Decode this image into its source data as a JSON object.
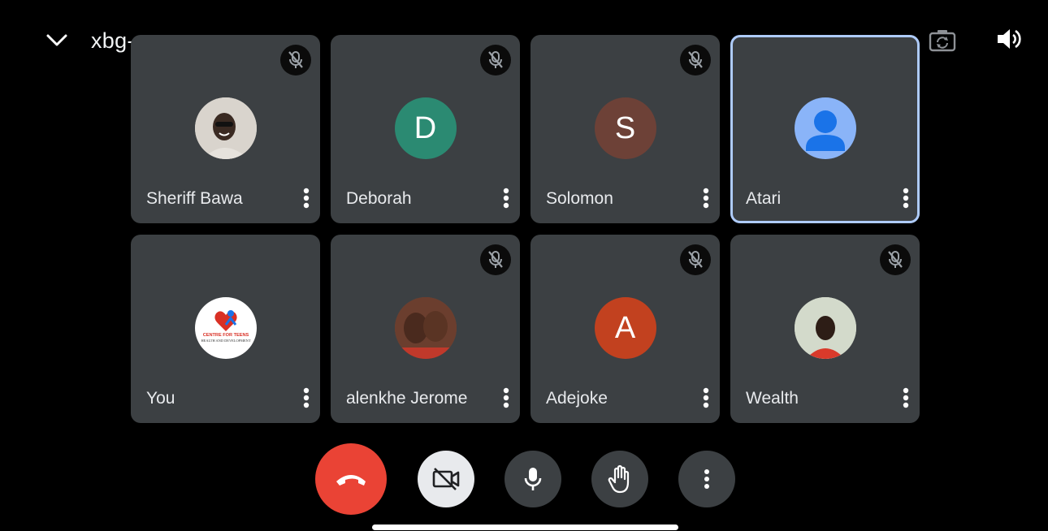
{
  "header": {
    "meeting_code": "xbg-napv-nog",
    "collapse_icon": "chevron-down-icon",
    "expand_icon": "caret-right-icon",
    "camera_switch_icon": "camera-flip-icon",
    "speaker_icon": "speaker-icon"
  },
  "participants": [
    {
      "name": "Sheriff Bawa",
      "avatar_type": "photo",
      "avatar_letter": "",
      "avatar_color": "#cfcac4",
      "muted": true,
      "active": false
    },
    {
      "name": "Deborah",
      "avatar_type": "letter",
      "avatar_letter": "D",
      "avatar_color": "#2b8a72",
      "muted": true,
      "active": false
    },
    {
      "name": "Solomon",
      "avatar_type": "letter",
      "avatar_letter": "S",
      "avatar_color": "#6d4137",
      "muted": true,
      "active": false
    },
    {
      "name": "Atari",
      "avatar_type": "generic",
      "avatar_letter": "",
      "avatar_color": "#8ab4f8",
      "muted": false,
      "active": true
    },
    {
      "name": "You",
      "avatar_type": "logo",
      "avatar_letter": "",
      "avatar_color": "#ffffff",
      "logo_text_1": "CENTRE FOR TEENS",
      "logo_text_2": "HEALTH AND DEVELOPMENT",
      "muted": false,
      "active": false
    },
    {
      "name": "alenkhe Jerome",
      "avatar_type": "photo",
      "avatar_letter": "",
      "avatar_color": "#7a4a3a",
      "muted": true,
      "active": false
    },
    {
      "name": "Adejoke",
      "avatar_type": "letter",
      "avatar_letter": "A",
      "avatar_color": "#c2411f",
      "muted": true,
      "active": false
    },
    {
      "name": "Wealth",
      "avatar_type": "photo",
      "avatar_letter": "",
      "avatar_color": "#cfd6c8",
      "muted": true,
      "active": false
    }
  ],
  "controls": {
    "end_call_icon": "end-call-icon",
    "camera_icon": "camera-off-icon",
    "mic_icon": "mic-icon",
    "hand_icon": "raise-hand-icon",
    "more_icon": "more-vert-icon"
  },
  "colors": {
    "background": "#000000",
    "tile": "#3c4043",
    "end_call": "#ea4335",
    "active_border": "#aecbfa"
  }
}
